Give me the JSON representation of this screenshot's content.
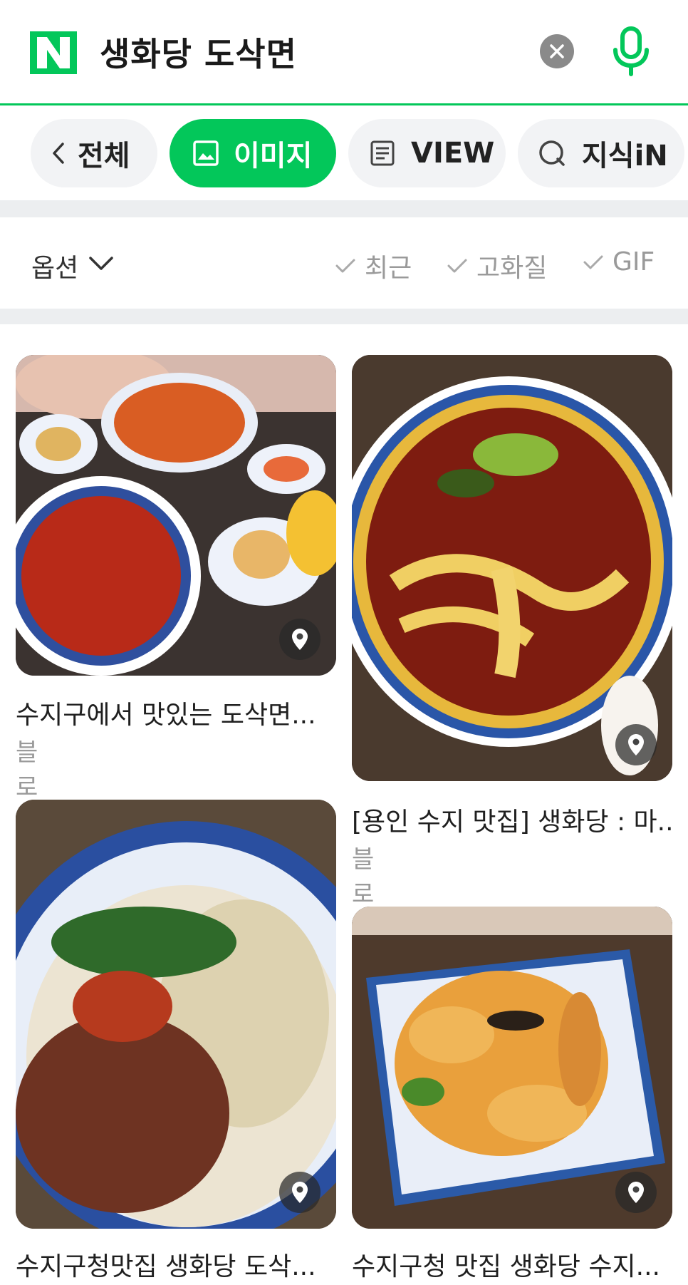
{
  "search": {
    "logo_letter": "N",
    "query": "생화당 도삭면"
  },
  "tabs": [
    {
      "label": "전체"
    },
    {
      "label": "이미지"
    },
    {
      "label": "VIEW"
    },
    {
      "label": "지식iN"
    }
  ],
  "options": {
    "label": "옵션",
    "filters": [
      "최근",
      "고화질",
      "GIF"
    ]
  },
  "results": [
    {
      "title": "수지구에서 맛있는 도삭면...",
      "source": "블로그"
    },
    {
      "title": "[용인 수지 맛집] 생화당 : 마...",
      "source": "블로그"
    },
    {
      "title": "수지구청맛집 생화당 도삭...",
      "source": ""
    },
    {
      "title": "수지구청 맛집 생화당 수지...",
      "source": ""
    }
  ],
  "colors": {
    "brand_green": "#03c75a",
    "tab_bg": "#f2f3f5",
    "muted_text": "#9a9a9a"
  }
}
